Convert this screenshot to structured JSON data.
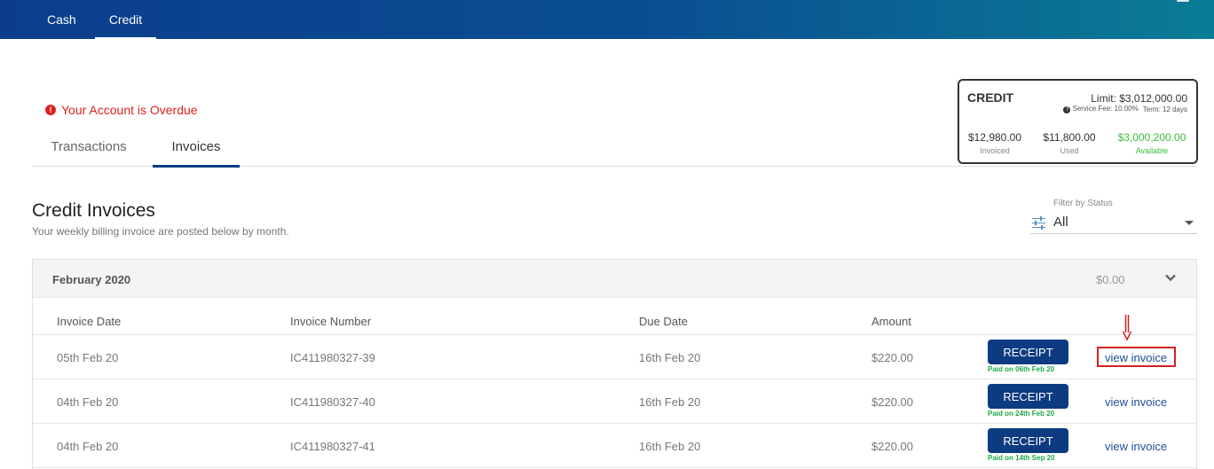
{
  "nav": {
    "tabs": [
      {
        "label": "Cash",
        "active": false
      },
      {
        "label": "Credit",
        "active": true
      }
    ]
  },
  "alert": {
    "text": "Your Account is Overdue",
    "color": "#e02020"
  },
  "sub_tabs": [
    {
      "label": "Transactions",
      "active": false
    },
    {
      "label": "Invoices",
      "active": true
    }
  ],
  "credit_summary": {
    "title": "CREDIT",
    "limit": "Limit: $3,012,000.00",
    "service_fee": "Service Fee: 10.00%",
    "term": "Term: 12 days",
    "invoiced": {
      "value": "$12,980.00",
      "label": "Invoiced"
    },
    "used": {
      "value": "$11,800.00",
      "label": "Used"
    },
    "available": {
      "value": "$3,000,200.00",
      "label": "Available",
      "color": "#3cbc3c"
    }
  },
  "page": {
    "title": "Credit Invoices",
    "subtitle": "Your weekly billing invoice are posted below by month."
  },
  "filter": {
    "label": "Filter by Status",
    "value": "All"
  },
  "month_group": {
    "month": "February 2020",
    "total": "$0.00",
    "columns": [
      "Invoice Date",
      "Invoice Number",
      "Due Date",
      "Amount"
    ],
    "rows": [
      {
        "invoice_date": "05th Feb 20",
        "invoice_number": "IC411980327-39",
        "due_date": "16th Feb 20",
        "amount": "$220.00",
        "receipt_label": "RECEIPT",
        "paid_text": "Paid on 06th Feb 20",
        "view_label": "view invoice"
      },
      {
        "invoice_date": "04th Feb 20",
        "invoice_number": "IC411980327-40",
        "due_date": "16th Feb 20",
        "amount": "$220.00",
        "receipt_label": "RECEIPT",
        "paid_text": "Paid on 24th Feb 20",
        "view_label": "view invoice"
      },
      {
        "invoice_date": "04th Feb 20",
        "invoice_number": "IC411980327-41",
        "due_date": "16th Feb 20",
        "amount": "$220.00",
        "receipt_label": "RECEIPT",
        "paid_text": "Paid on 14th Sep 20",
        "view_label": "view invoice"
      }
    ]
  },
  "colors": {
    "brand": "#0d3b82",
    "link": "#1e4f98",
    "paid": "#1ca84a",
    "highlight": "#d62020"
  },
  "icons": [
    "alert-circle-icon",
    "question-circle-icon",
    "filter-sliders-icon",
    "caret-down-icon",
    "chevron-down-icon",
    "down-arrow-icon"
  ]
}
